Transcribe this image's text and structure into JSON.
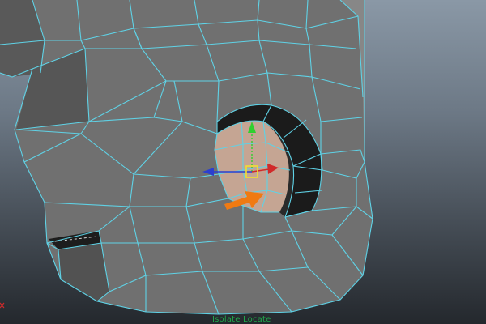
{
  "viewport": {
    "status_label": "Isolate Locate",
    "colors": {
      "wireframe": "#5fd2e6",
      "mesh_face": "#6e6e6e",
      "mesh_face_dark": "#4c4c4c",
      "mesh_face_light": "#858585",
      "interior_dark": "#1a1a1a",
      "selected_face": "#c9a996",
      "gizmo_y": "#2fd02f",
      "gizmo_x": "#d12a2a",
      "gizmo_z": "#2b3fcf",
      "gizmo_center": "#f0e030",
      "annotation_arrow": "#f07a12",
      "axis_corner": "#d22a2a",
      "status_text": "#1fa84a"
    },
    "icons": {
      "move_gizmo": "move-manipulator-icon",
      "annotation": "arrow-right-icon"
    }
  }
}
